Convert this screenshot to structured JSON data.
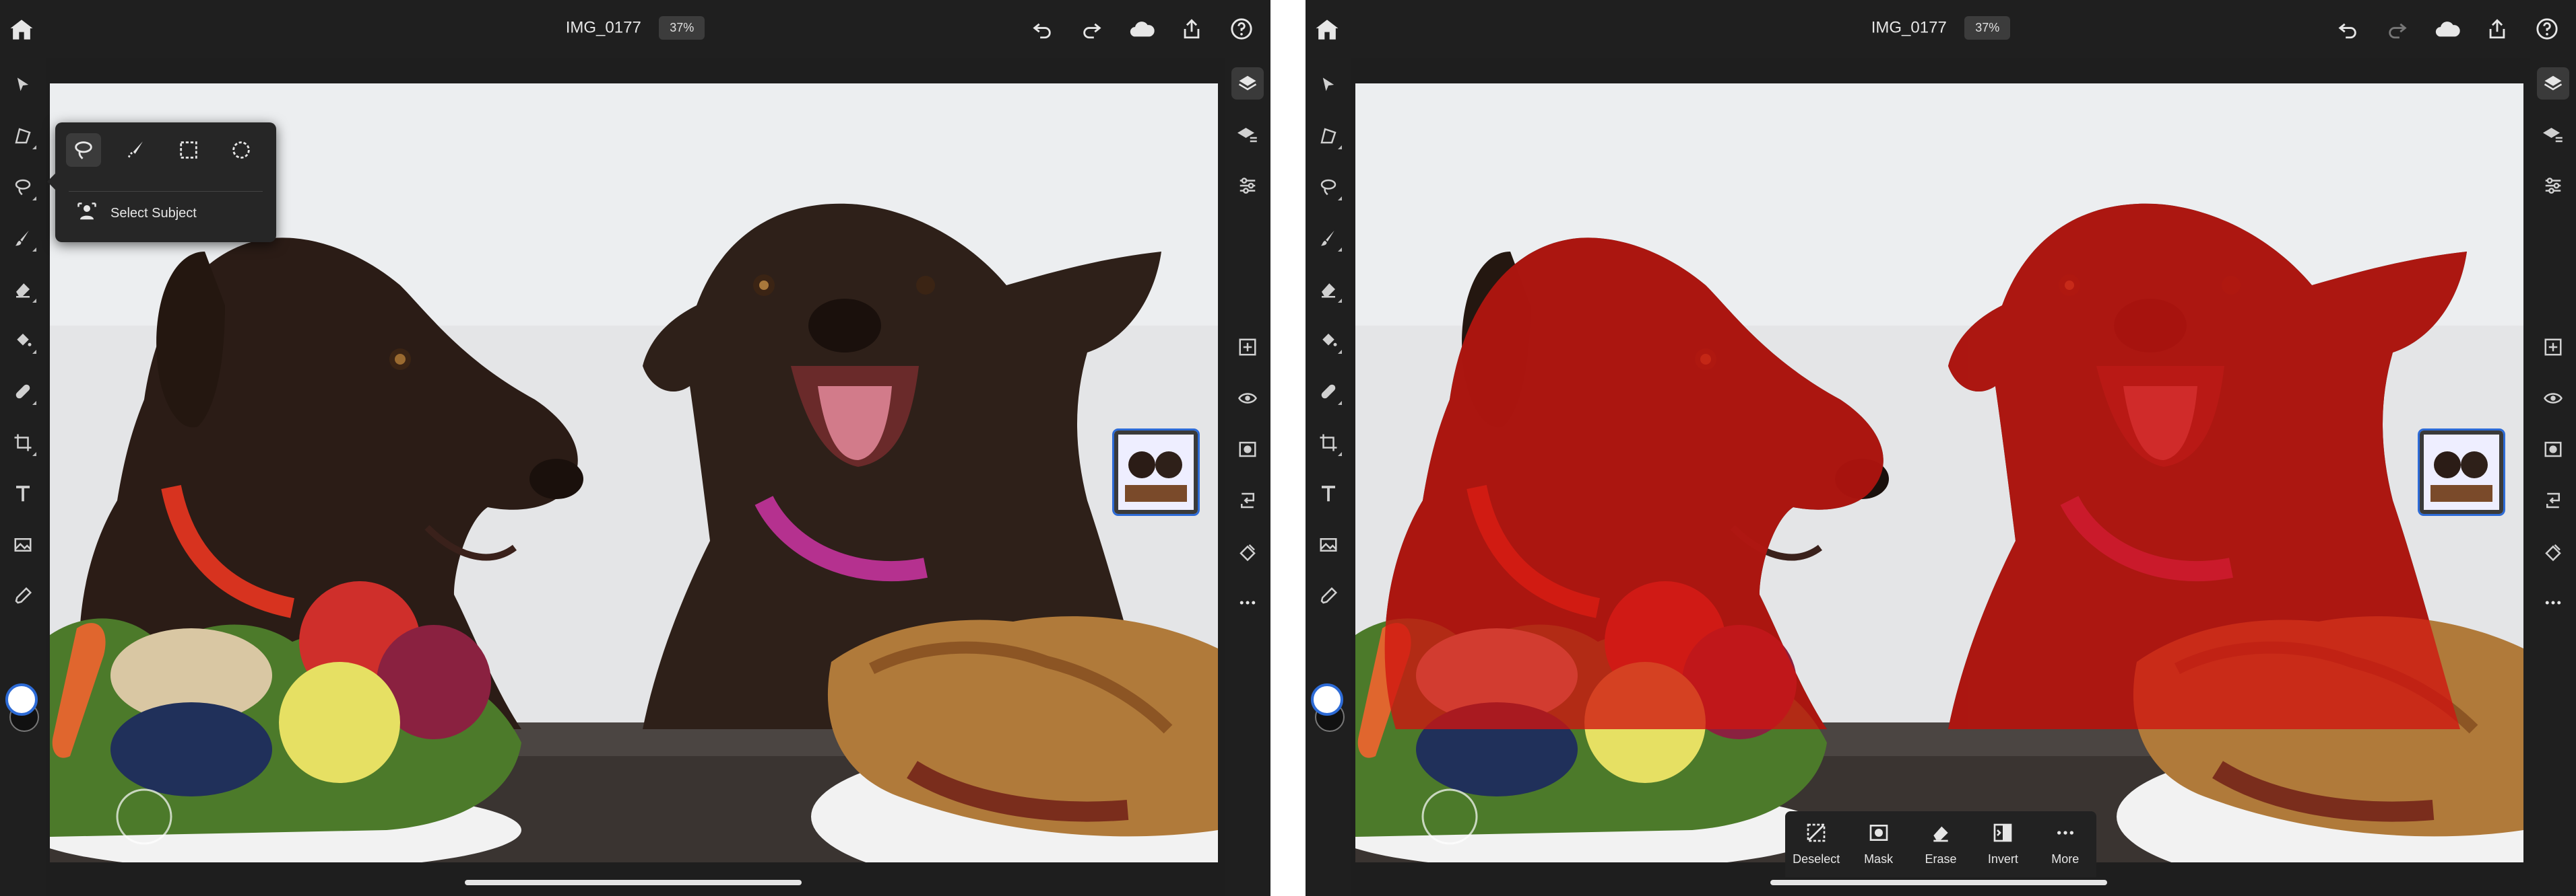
{
  "document": {
    "title": "IMG_0177",
    "zoom": "37%"
  },
  "icons": {
    "home": "home-icon",
    "undo": "undo-icon",
    "redo": "redo-icon",
    "cloud": "cloud-icon",
    "share": "share-icon",
    "help": "help-icon",
    "select": "move-arrow-icon",
    "transform": "transform-icon",
    "lasso": "lasso-icon",
    "brush": "brush-icon",
    "eraser": "eraser-icon",
    "fill": "paint-bucket-icon",
    "heal": "heal-bandage-icon",
    "crop": "crop-icon",
    "type": "type-icon",
    "image": "place-image-icon",
    "eyedropper": "eyedropper-icon",
    "layers": "layers-icon",
    "layer-properties": "layer-properties-icon",
    "adjustments": "adjustments-sliders-icon",
    "add-layer": "add-layer-icon",
    "visibility": "eye-icon",
    "mask": "mask-icon",
    "merge": "merge-down-icon",
    "opacity": "opacity-icon",
    "more": "more-icon"
  },
  "colors": {
    "accent": "#2d6bd6",
    "selection_overlay": "#d0140f",
    "ui_background": "#1e1e1e",
    "foreground_color": "#ffffff",
    "background_color": "#111111"
  },
  "selection_popover": {
    "tools": [
      "lasso-select-icon",
      "brush-select-icon",
      "rect-marquee-icon",
      "ellipse-marquee-icon"
    ],
    "select_subject_label": "Select Subject"
  },
  "action_bar": {
    "deselect": "Deselect",
    "mask": "Mask",
    "erase": "Erase",
    "invert": "Invert",
    "more": "More"
  }
}
